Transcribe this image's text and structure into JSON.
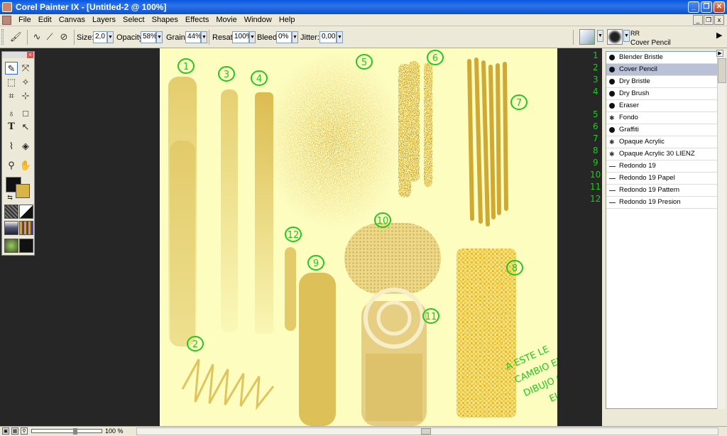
{
  "window": {
    "title": "Corel Painter IX - [Untitled-2 @ 100%]",
    "minimize_glyph": "_",
    "maximize_glyph": "❐",
    "close_glyph": "✕"
  },
  "menubar": {
    "items": [
      "File",
      "Edit",
      "Canvas",
      "Layers",
      "Select",
      "Shapes",
      "Effects",
      "Movie",
      "Window",
      "Help"
    ],
    "mdi_minimize": "_",
    "mdi_restore": "❐",
    "mdi_close": "x"
  },
  "propbar": {
    "size_label": "Size:",
    "size_value": "2,0",
    "opacity_label": "Opacity:",
    "opacity_value": "58%",
    "grain_label": "Grain:",
    "grain_value": "44%",
    "resat_label": "Resat:",
    "resat_value": "100%",
    "bleed_label": "Bleed:",
    "bleed_value": "0%",
    "jitter_label": "Jitter:",
    "jitter_value": "0,00",
    "dropdown_glyph": "▼"
  },
  "brush_selector": {
    "category": "RR",
    "variant": "Cover Pencil",
    "arrow_glyph": "▶"
  },
  "toolbox": {
    "close_glyph": "x"
  },
  "brush_list": {
    "items": [
      {
        "label": "Blender Bristle",
        "icon": "dot"
      },
      {
        "label": "Cover Pencil",
        "icon": "dot",
        "selected": true
      },
      {
        "label": "Dry Bristle",
        "icon": "dot"
      },
      {
        "label": "Dry Brush",
        "icon": "dot"
      },
      {
        "label": "Eraser",
        "icon": "dot"
      },
      {
        "label": "Fondo",
        "icon": "star"
      },
      {
        "label": "Graffiti",
        "icon": "dot"
      },
      {
        "label": "Opaque Acrylic",
        "icon": "star"
      },
      {
        "label": "Opaque Acrylic 30 LIENZ",
        "icon": "star"
      },
      {
        "label": "Redondo 19",
        "icon": "line"
      },
      {
        "label": "Redondo 19 Papel",
        "icon": "line"
      },
      {
        "label": "Redondo 19 Pattern",
        "icon": "line"
      },
      {
        "label": "Redondo 19 Presion",
        "icon": "line"
      }
    ],
    "row_numbers": [
      "1",
      "2",
      "3",
      "4",
      "5",
      "6",
      "7",
      "8",
      "9",
      "10",
      "11",
      "12"
    ]
  },
  "canvas_annotations": {
    "stroke_numbers": [
      "1",
      "2",
      "3",
      "4",
      "5",
      "6",
      "7",
      "8",
      "9",
      "10",
      "11",
      "12"
    ],
    "note_lines": [
      "A ESTE LE",
      "CAMBIO EL",
      "DIBUJO CAMBIANDO",
      "EL PAPEL"
    ]
  },
  "statusbar": {
    "zoom": "100 %"
  },
  "colors": {
    "canvas": "#fdfdc0",
    "paint": "#d8b545",
    "annotation": "#22c722",
    "workspace": "#262626"
  }
}
